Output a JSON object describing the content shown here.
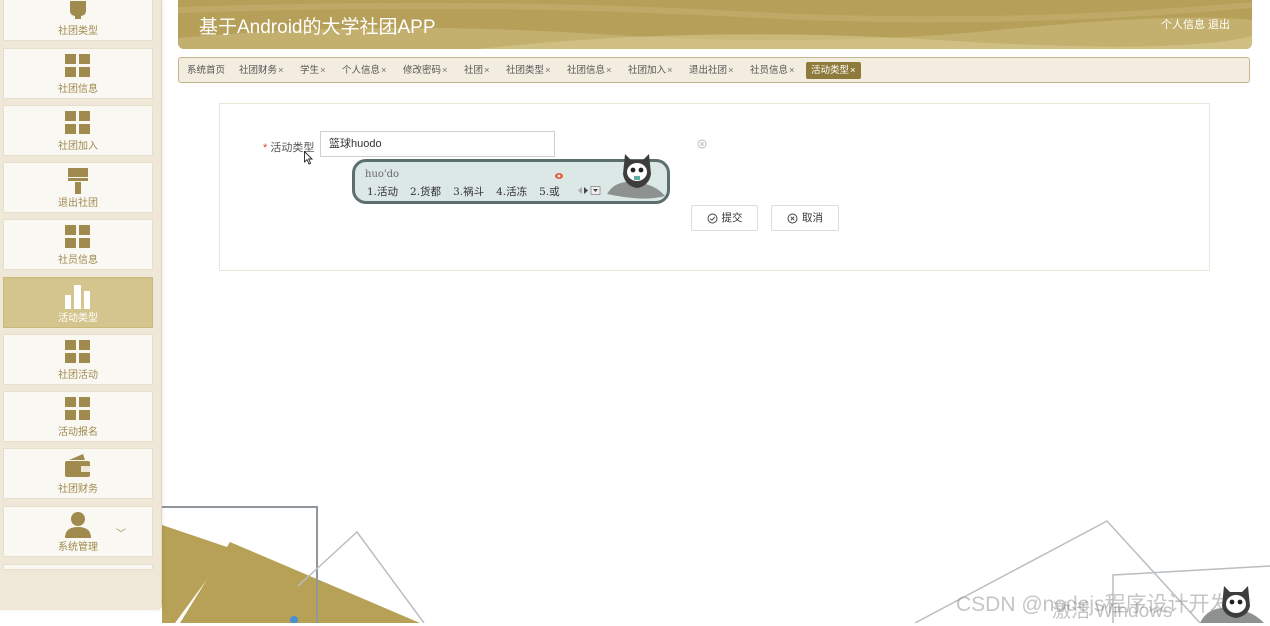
{
  "app": {
    "title": "基于Android的大学社团APP",
    "user_link": "个人信息",
    "logout_link": "退出"
  },
  "sidebar": {
    "items": [
      {
        "label": "社团类型",
        "icon": "bulb-icon"
      },
      {
        "label": "社团信息",
        "icon": "grid-icon"
      },
      {
        "label": "社团加入",
        "icon": "grid-icon"
      },
      {
        "label": "退出社团",
        "icon": "brush-icon"
      },
      {
        "label": "社员信息",
        "icon": "grid-icon"
      },
      {
        "label": "活动类型",
        "icon": "bar-chart-icon",
        "active": true
      },
      {
        "label": "社团活动",
        "icon": "grid-icon"
      },
      {
        "label": "活动报名",
        "icon": "grid-icon"
      },
      {
        "label": "社团财务",
        "icon": "wallet-icon"
      },
      {
        "label": "系统管理",
        "icon": "user-icon",
        "expand": "﹀"
      }
    ]
  },
  "tabs": [
    {
      "label": "系统首页",
      "close": ""
    },
    {
      "label": "社团财务",
      "close": "×"
    },
    {
      "label": "学生",
      "close": "×"
    },
    {
      "label": "个人信息",
      "close": "×"
    },
    {
      "label": "修改密码",
      "close": "×"
    },
    {
      "label": "社团",
      "close": "×"
    },
    {
      "label": "社团类型",
      "close": "×"
    },
    {
      "label": "社团信息",
      "close": "×"
    },
    {
      "label": "社团加入",
      "close": "×"
    },
    {
      "label": "退出社团",
      "close": "×"
    },
    {
      "label": "社员信息",
      "close": "×"
    },
    {
      "label": "活动类型",
      "close": "×",
      "active": true
    }
  ],
  "form": {
    "required_mark": "*",
    "field_label": "活动类型",
    "field_value": "篮球huodo",
    "submit_label": "提交",
    "cancel_label": "取消"
  },
  "ime": {
    "pinyin": "huo'do",
    "candidates": [
      "1.活动",
      "2.货都",
      "3.祸斗",
      "4.活冻",
      "5.或"
    ]
  },
  "overlay": {
    "watermark": "CSDN @nodejs程序设计开发",
    "activate_text": "激活 Windows"
  },
  "colors": {
    "brand": "#b59f59",
    "sidebar_active": "#d4c48e",
    "tab_active": "#8e7a3b",
    "required": "#e04040"
  }
}
